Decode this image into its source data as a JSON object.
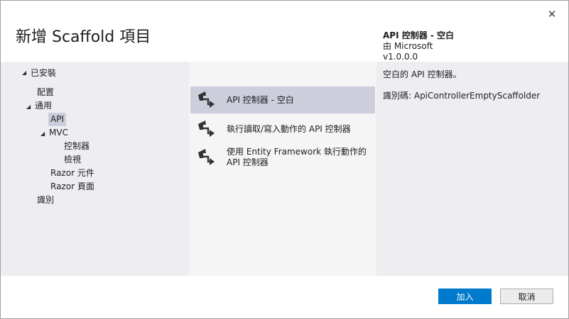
{
  "dialog": {
    "title": "新增 Scaffold 項目",
    "close_glyph": "✕"
  },
  "tree": {
    "root": "已安裝",
    "arrow_glyph": "◢",
    "items": [
      {
        "label": "配置"
      },
      {
        "label": "通用"
      },
      {
        "label": "API",
        "selected": true
      },
      {
        "label": "MVC"
      },
      {
        "label": "控制器"
      },
      {
        "label": "檢視"
      },
      {
        "label": "Razor 元件"
      },
      {
        "label": "Razor 頁面"
      },
      {
        "label": "識別"
      }
    ]
  },
  "templates": [
    {
      "label": "API 控制器 - 空白",
      "icon": "scaffold-controller-icon",
      "selected": true
    },
    {
      "label": "執行讀取/寫入動作的 API 控制器",
      "icon": "scaffold-controller-icon"
    },
    {
      "label": "使用 Entity Framework 執行動作的 API 控制器",
      "icon": "scaffold-controller-icon"
    }
  ],
  "details": {
    "name": "API 控制器 - 空白",
    "publisher": "由 Microsoft",
    "version": "v1.0.0.0",
    "description": "空白的 API 控制器。",
    "id": "識別碼: ApiControllerEmptyScaffolder"
  },
  "buttons": {
    "add": "加入",
    "cancel": "取消"
  },
  "colors": {
    "accent": "#007acc",
    "selection": "#cccedb",
    "panel": "#eeeef2"
  }
}
